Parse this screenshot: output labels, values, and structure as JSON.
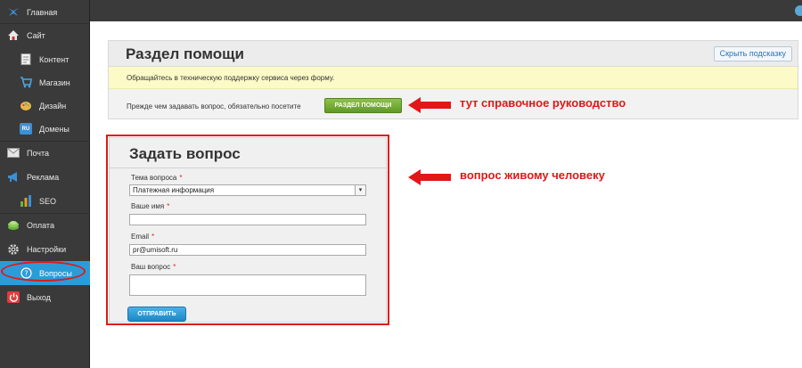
{
  "sidebar": {
    "items": [
      {
        "label": "Главная",
        "icon": "bird-logo-icon",
        "color": "#3d8fd6"
      },
      {
        "label": "Сайт",
        "icon": "home-icon",
        "color": "#d9d9d9"
      },
      {
        "label": "Контент",
        "icon": "document-icon",
        "color": "#e8e8e8"
      },
      {
        "label": "Магазин",
        "icon": "cart-icon",
        "color": "#4aa7df"
      },
      {
        "label": "Дизайн",
        "icon": "palette-icon",
        "color": "#e6b64a"
      },
      {
        "label": "Домены",
        "icon": "ru-domain-icon",
        "color": "#3d8fd6"
      },
      {
        "label": "Почта",
        "icon": "envelope-icon",
        "color": "#cfcfcf"
      },
      {
        "label": "Реклама",
        "icon": "megaphone-icon",
        "color": "#3d8fd6"
      },
      {
        "label": "SEO",
        "icon": "bar-chart-icon",
        "color": "#e0a020"
      },
      {
        "label": "Оплата",
        "icon": "money-icon",
        "color": "#6cb33f"
      },
      {
        "label": "Настройки",
        "icon": "gear-icon",
        "color": "#cfcfcf"
      },
      {
        "label": "Вопросы",
        "icon": "question-circle-icon",
        "color": "#ffffff"
      },
      {
        "label": "Выход",
        "icon": "power-icon",
        "color": "#e03c3c"
      }
    ],
    "active": "Вопросы"
  },
  "help_panel": {
    "title": "Раздел помощи",
    "hide_button": "Скрыть подсказку",
    "note": "Обращайтесь в техническую поддержку сервиса через форму.",
    "prompt_text": "Прежде чем задавать вопрос, обязательно посетите",
    "help_button": "РАЗДЕЛ ПОМОЩИ"
  },
  "annotations": {
    "help_arrow_text": "тут справочное руководство",
    "form_arrow_text": "вопрос живому человеку",
    "color": "#e01818"
  },
  "form": {
    "title": "Задать вопрос",
    "topic_label": "Тема вопроса",
    "topic_value": "Платежная информация",
    "name_label": "Ваше имя",
    "name_value": "",
    "email_label": "Email",
    "email_value": "pr@umisoft.ru",
    "question_label": "Ваш вопрос",
    "question_value": "",
    "required_mark": "*",
    "submit": "ОТПРАВИТЬ"
  }
}
